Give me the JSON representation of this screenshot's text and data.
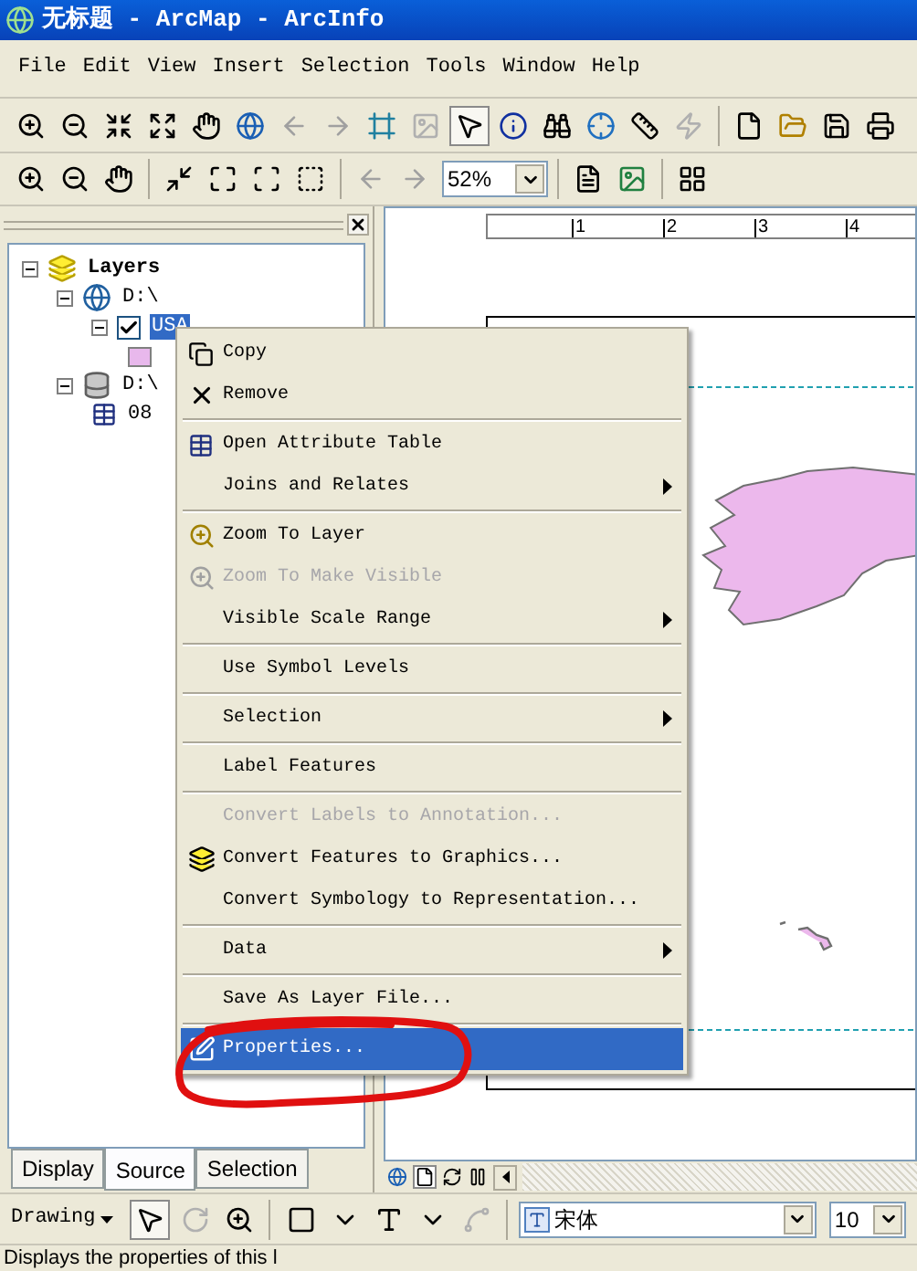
{
  "window": {
    "title": "无标题 - ArcMap - ArcInfo"
  },
  "menu_bar": [
    "File",
    "Edit",
    "View",
    "Insert",
    "Selection",
    "Tools",
    "Window",
    "Help"
  ],
  "standard_toolbar": {
    "select_tool_selected": true
  },
  "layout_toolbar": {
    "zoom_value": "52%"
  },
  "toc": {
    "tree": [
      {
        "label": "Layers",
        "kind": "frame",
        "expanded": true,
        "children": [
          {
            "label": "D:\\",
            "kind": "folder",
            "expanded": true,
            "children": [
              {
                "label": "USA",
                "kind": "layer",
                "checked": true,
                "selected": true,
                "expanded": true,
                "children": [
                  {
                    "kind": "swatch",
                    "color": "#e8b8ec"
                  }
                ]
              }
            ]
          },
          {
            "label": "D:\\",
            "kind": "database",
            "expanded": true,
            "children": [
              {
                "label": "08",
                "kind": "table"
              }
            ]
          }
        ]
      }
    ],
    "tabs": [
      {
        "label": "Display",
        "selected": false
      },
      {
        "label": "Source",
        "selected": true
      },
      {
        "label": "Selection",
        "selected": false
      }
    ]
  },
  "ruler_labels": [
    "1",
    "2",
    "3",
    "4"
  ],
  "context_menu": [
    {
      "kind": "item",
      "label": "Copy",
      "disabled": false,
      "selected": false,
      "submenu": false
    },
    {
      "kind": "item",
      "label": "Remove",
      "disabled": false,
      "selected": false,
      "submenu": false
    },
    {
      "kind": "separator"
    },
    {
      "kind": "item",
      "label": "Open Attribute Table",
      "disabled": false,
      "selected": false,
      "submenu": false
    },
    {
      "kind": "item",
      "label": "Joins and Relates",
      "disabled": false,
      "selected": false,
      "submenu": true
    },
    {
      "kind": "separator"
    },
    {
      "kind": "item",
      "label": "Zoom To Layer",
      "disabled": false,
      "selected": false,
      "submenu": false
    },
    {
      "kind": "item",
      "label": "Zoom To Make Visible",
      "disabled": true,
      "selected": false,
      "submenu": false
    },
    {
      "kind": "item",
      "label": "Visible Scale Range",
      "disabled": false,
      "selected": false,
      "submenu": true
    },
    {
      "kind": "separator"
    },
    {
      "kind": "item",
      "label": "Use Symbol Levels",
      "disabled": false,
      "selected": false,
      "submenu": false
    },
    {
      "kind": "separator"
    },
    {
      "kind": "item",
      "label": "Selection",
      "disabled": false,
      "selected": false,
      "submenu": true
    },
    {
      "kind": "separator"
    },
    {
      "kind": "item",
      "label": "Label Features",
      "disabled": false,
      "selected": false,
      "submenu": false
    },
    {
      "kind": "separator"
    },
    {
      "kind": "item",
      "label": "Convert Labels to Annotation...",
      "disabled": true,
      "selected": false,
      "submenu": false
    },
    {
      "kind": "item",
      "label": "Convert Features to Graphics...",
      "disabled": false,
      "selected": false,
      "submenu": false
    },
    {
      "kind": "item",
      "label": "Convert Symbology to Representation...",
      "disabled": false,
      "selected": false,
      "submenu": false
    },
    {
      "kind": "separator"
    },
    {
      "kind": "item",
      "label": "Data",
      "disabled": false,
      "selected": false,
      "submenu": true
    },
    {
      "kind": "separator"
    },
    {
      "kind": "item",
      "label": "Save As Layer File...",
      "disabled": false,
      "selected": false,
      "submenu": false
    },
    {
      "kind": "separator"
    },
    {
      "kind": "item",
      "label": "Properties...",
      "disabled": false,
      "selected": true,
      "submenu": false
    }
  ],
  "drawing_toolbar": {
    "label": "Drawing",
    "select_tool_selected": true,
    "font": "宋体",
    "font_size": "10"
  },
  "status_bar": "Displays the properties of this l"
}
